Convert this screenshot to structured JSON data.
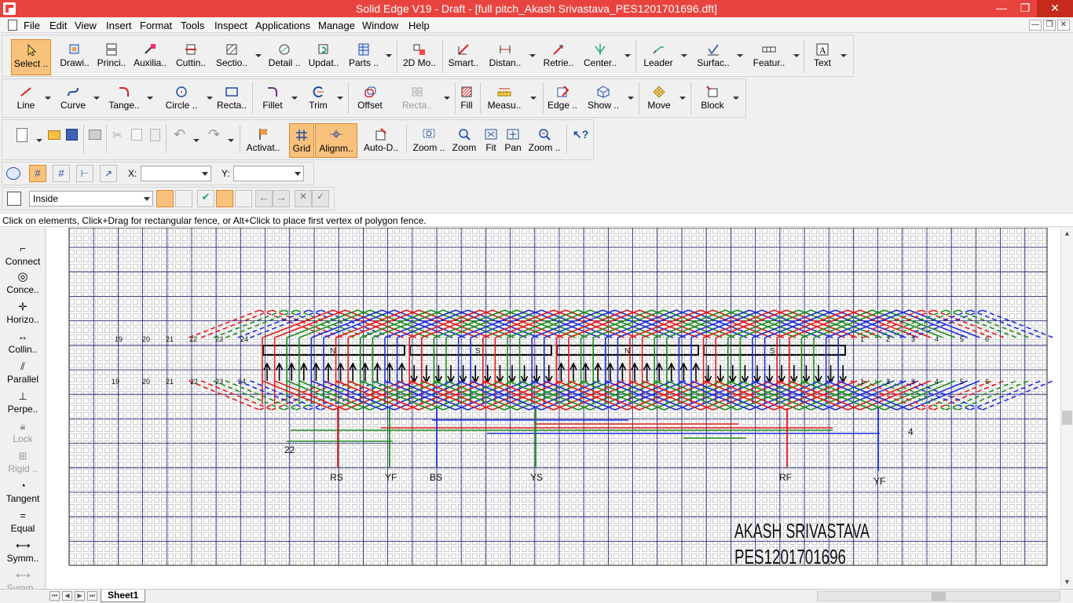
{
  "window": {
    "title": "Solid Edge V19 - Draft - [full pitch_Akash Srivastava_PES1201701696.dft]",
    "minimize": "—",
    "maximize": "❐",
    "close": "✕"
  },
  "menu": [
    "File",
    "Edit",
    "View",
    "Insert",
    "Format",
    "Tools",
    "Inspect",
    "Applications",
    "Manage",
    "Window",
    "Help"
  ],
  "toolbar1": [
    "Select ..",
    "Drawi..",
    "Princi..",
    "Auxilia..",
    "Cuttin..",
    "Sectio..",
    "Detail ..",
    "Updat..",
    "Parts ..",
    "2D Mo..",
    "Smart..",
    "Distan..",
    "Retrie..",
    "Center..",
    "Leader",
    "Surfac..",
    "Featur..",
    "Text"
  ],
  "toolbar2": [
    "Line",
    "Curve",
    "Tange..",
    "Circle ..",
    "Recta..",
    "Fillet",
    "Trim",
    "Offset",
    "Recta..",
    "Fill",
    "Measu..",
    "Edge ..",
    "Show ..",
    "Move",
    "Block"
  ],
  "toolbar3": [
    "Activat..",
    "Grid",
    "Alignm..",
    "Auto-D..",
    "Zoom ..",
    "Zoom",
    "Fit",
    "Pan",
    "Zoom .."
  ],
  "coords": {
    "x_label": "X:",
    "y_label": "Y:",
    "x_value": "",
    "y_value": ""
  },
  "select_filter": {
    "value": "Inside"
  },
  "status_prompt": "Click on elements, Click+Drag for rectangular fence, or Alt+Click to place first vertex of polygon fence.",
  "relationships": [
    "Connect",
    "Conce..",
    "Horizo..",
    "Collin..",
    "Parallel",
    "Perpe..",
    "Lock",
    "Rigid ..",
    "Tangent",
    "Equal",
    "Symm..",
    "Symm.."
  ],
  "sheet_tab": "Sheet1",
  "drawing": {
    "slot_numbers_top": [
      "19",
      "20",
      "21",
      "22",
      "23",
      "24",
      "1",
      "2",
      "3",
      "4",
      "5",
      "6"
    ],
    "slot_numbers_bottom": [
      "19",
      "20",
      "21",
      "22",
      "23",
      "24",
      "1",
      "2",
      "3",
      "4",
      "5",
      "6"
    ],
    "pole_labels": [
      "N",
      "S",
      "N",
      "S"
    ],
    "terminal_labels": [
      "RS",
      "YF",
      "BS",
      "YS",
      "RF",
      "YF"
    ],
    "side_labels": [
      "22",
      "4"
    ],
    "author": "AKASH SRIVASTAVA",
    "srn": "PES1201701696"
  },
  "colors": {
    "title_bar": "#e9433f",
    "grid_major": "#1a1a6e",
    "phase_r": "#e41a1a",
    "phase_y": "#1f8c1f",
    "phase_b": "#1f2fd6",
    "active_btn": "#f9c27c"
  }
}
